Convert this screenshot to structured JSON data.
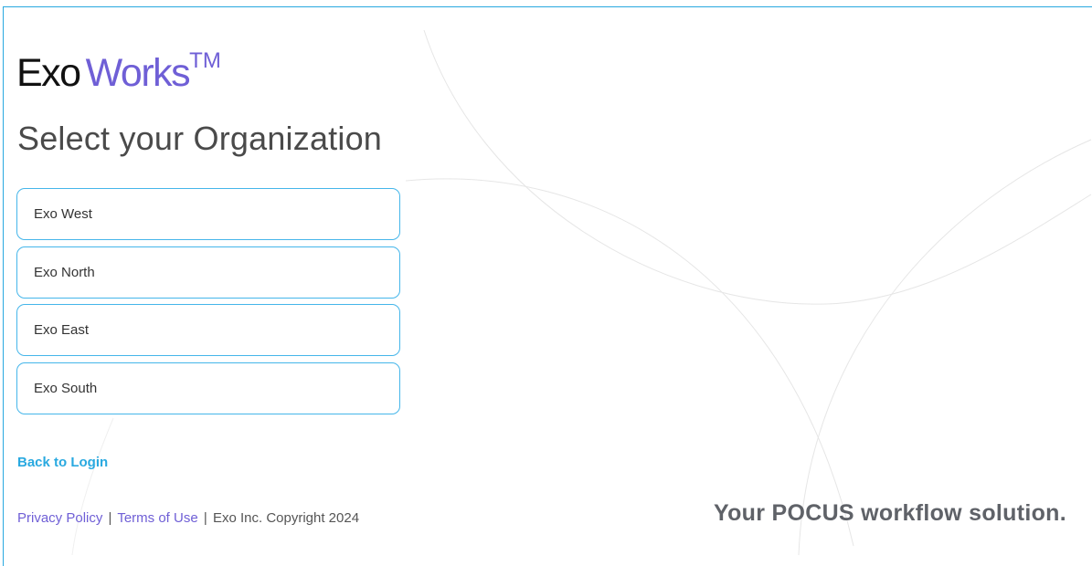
{
  "brand": {
    "name_part1": "Exo",
    "name_part2": "Works",
    "trademark": "TM",
    "accent_color": "#6f5fd6"
  },
  "page": {
    "title": "Select your Organization"
  },
  "organizations": [
    {
      "label": "Exo West"
    },
    {
      "label": "Exo North"
    },
    {
      "label": "Exo East"
    },
    {
      "label": "Exo South"
    }
  ],
  "navigation": {
    "back_label": "Back to Login",
    "link_color": "#29a9e0"
  },
  "footer": {
    "privacy_label": "Privacy Policy",
    "separator": "|",
    "terms_label": "Terms of Use",
    "copyright": "Exo Inc. Copyright 2024"
  },
  "tagline": "Your POCUS workflow solution."
}
